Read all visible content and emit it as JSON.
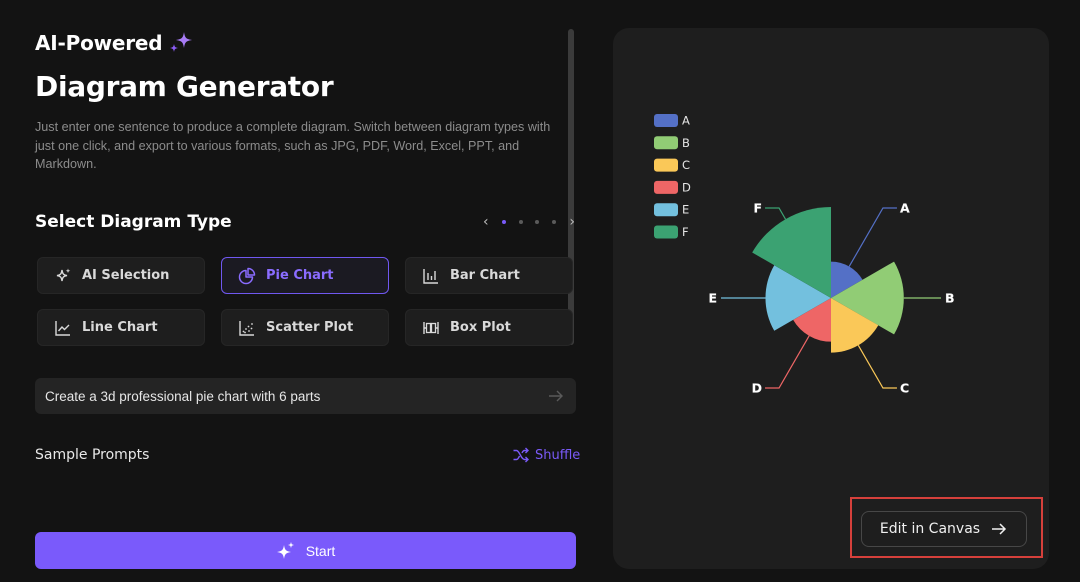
{
  "header": {
    "eyebrow": "AI-Powered",
    "eyebrow_icon": "sparkle-icon",
    "title": "Diagram Generator",
    "description": "Just enter one sentence to produce a complete diagram. Switch between diagram types with just one click, and export to various formats, such as JPG, PDF, Word, Excel, PPT, and Markdown."
  },
  "diagram_types": {
    "title": "Select Diagram Type",
    "pager": {
      "prev": "‹",
      "next": "›",
      "pages": 4,
      "current": 1
    },
    "items": [
      {
        "label": "AI Selection",
        "icon": "ai-sparkle-icon",
        "active": false
      },
      {
        "label": "Pie Chart",
        "icon": "pie-chart-icon",
        "active": true
      },
      {
        "label": "Bar Chart",
        "icon": "bar-chart-icon",
        "active": false
      },
      {
        "label": "Line Chart",
        "icon": "line-chart-icon",
        "active": false
      },
      {
        "label": "Scatter Plot",
        "icon": "scatter-plot-icon",
        "active": false
      },
      {
        "label": "Box Plot",
        "icon": "box-plot-icon",
        "active": false
      }
    ]
  },
  "prompt": {
    "value": "Create a 3d professional pie chart with 6 parts",
    "send_icon": "arrow-right-icon"
  },
  "sample_prompts": {
    "label": "Sample Prompts",
    "shuffle_label": "Shuffle"
  },
  "start_button": {
    "label": "Start"
  },
  "preview": {
    "edit_button": "Edit in Canvas"
  },
  "colors": {
    "accent": "#7a5afb",
    "background": "#131313",
    "panel": "#1e1e1e",
    "highlight": "#d6403b"
  },
  "chart_data": {
    "type": "pie",
    "subtype": "rose",
    "categories": [
      "A",
      "B",
      "C",
      "D",
      "E",
      "F"
    ],
    "values": [
      10,
      20,
      15,
      12,
      18,
      25
    ],
    "colors": [
      "#5470c6",
      "#91cc75",
      "#fac858",
      "#ee6666",
      "#73c0de",
      "#3ba272"
    ],
    "legend": {
      "entries": [
        "A",
        "B",
        "C",
        "D",
        "E",
        "F"
      ],
      "placement": "top-left"
    },
    "title": "",
    "labels_shown": true
  }
}
